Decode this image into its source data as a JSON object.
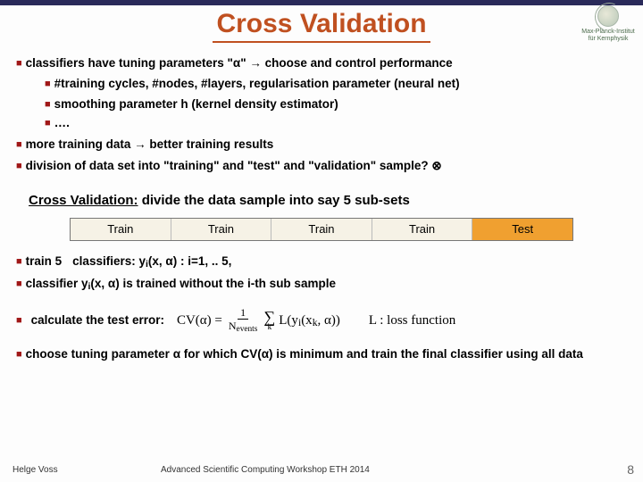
{
  "title": "Cross Validation",
  "logo_text1": "Max-Planck-Institut",
  "logo_text2": "für Kernphysik",
  "b1": "classifiers have tuning parameters \"α\"  →  choose and control performance",
  "b1a": "#training cycles, #nodes, #layers, regularisation parameter (neural net)",
  "b1b": "smoothing parameter h  (kernel density estimator)",
  "b1c": "….",
  "b2": "more training data → better training results",
  "b3": "division of data set into  \"training\" and \"test\" and \"validation\" sample? ⊗",
  "cv_heading_u": "Cross Validation:",
  "cv_heading_rest": " divide the data sample into say 5 sub-sets",
  "seg_train": "Train",
  "seg_test": "Test",
  "b4_a": "train 5",
  "b4_b": "classifiers:  y",
  "b4_c": "(x, α) : i=1, .. 5,",
  "b5_a": "classifier y",
  "b5_b": "(x, α) is trained without the i-th sub sample",
  "b6": "calculate the test error:",
  "formula_lhs": "CV(α) = ",
  "formula_num": "1",
  "formula_den": "N",
  "formula_den_sub": "events",
  "formula_sum_top": "",
  "formula_sum_bot": "k",
  "formula_rhs": "L(y",
  "formula_rhs_sub": "i",
  "formula_rhs2": "(x",
  "formula_rhs2_sub": "k",
  "formula_rhs3": ", α))",
  "formula_note": "L : loss function",
  "b7": "choose tuning parameter α for which CV(α) is minimum and train the final classifier using all data",
  "footer_author": "Helge Voss",
  "footer_conf": "Advanced Scientific Computing Workshop ETH 2014",
  "page_num": "8"
}
